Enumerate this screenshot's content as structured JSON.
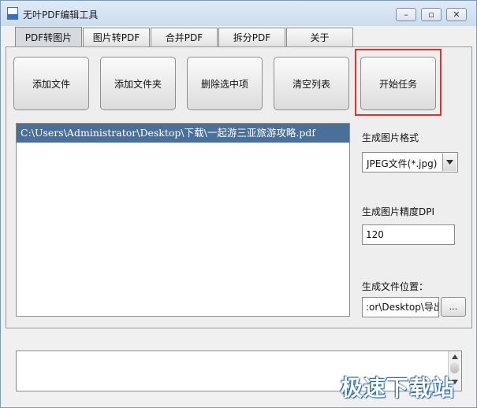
{
  "window": {
    "title": "无叶PDF编辑工具"
  },
  "tabs": [
    "PDF转图片",
    "图片转PDF",
    "合并PDF",
    "拆分PDF",
    "关于"
  ],
  "toolbar": {
    "add_file": "添加文件",
    "add_folder": "添加文件夹",
    "delete_selected": "删除选中项",
    "clear_list": "清空列表",
    "start_task": "开始任务"
  },
  "file_list": [
    "C:\\Users\\Administrator\\Desktop\\下载\\一起游三亚旅游攻略.pdf"
  ],
  "settings": {
    "format_label": "生成图片格式",
    "format_value": "JPEG文件(*.jpg)",
    "dpi_label": "生成图片精度DPI",
    "dpi_value": "120",
    "location_label": "生成文件位置：",
    "location_value": ":or\\Desktop\\导出",
    "browse_label": "..."
  },
  "watermark": "极速下载站"
}
